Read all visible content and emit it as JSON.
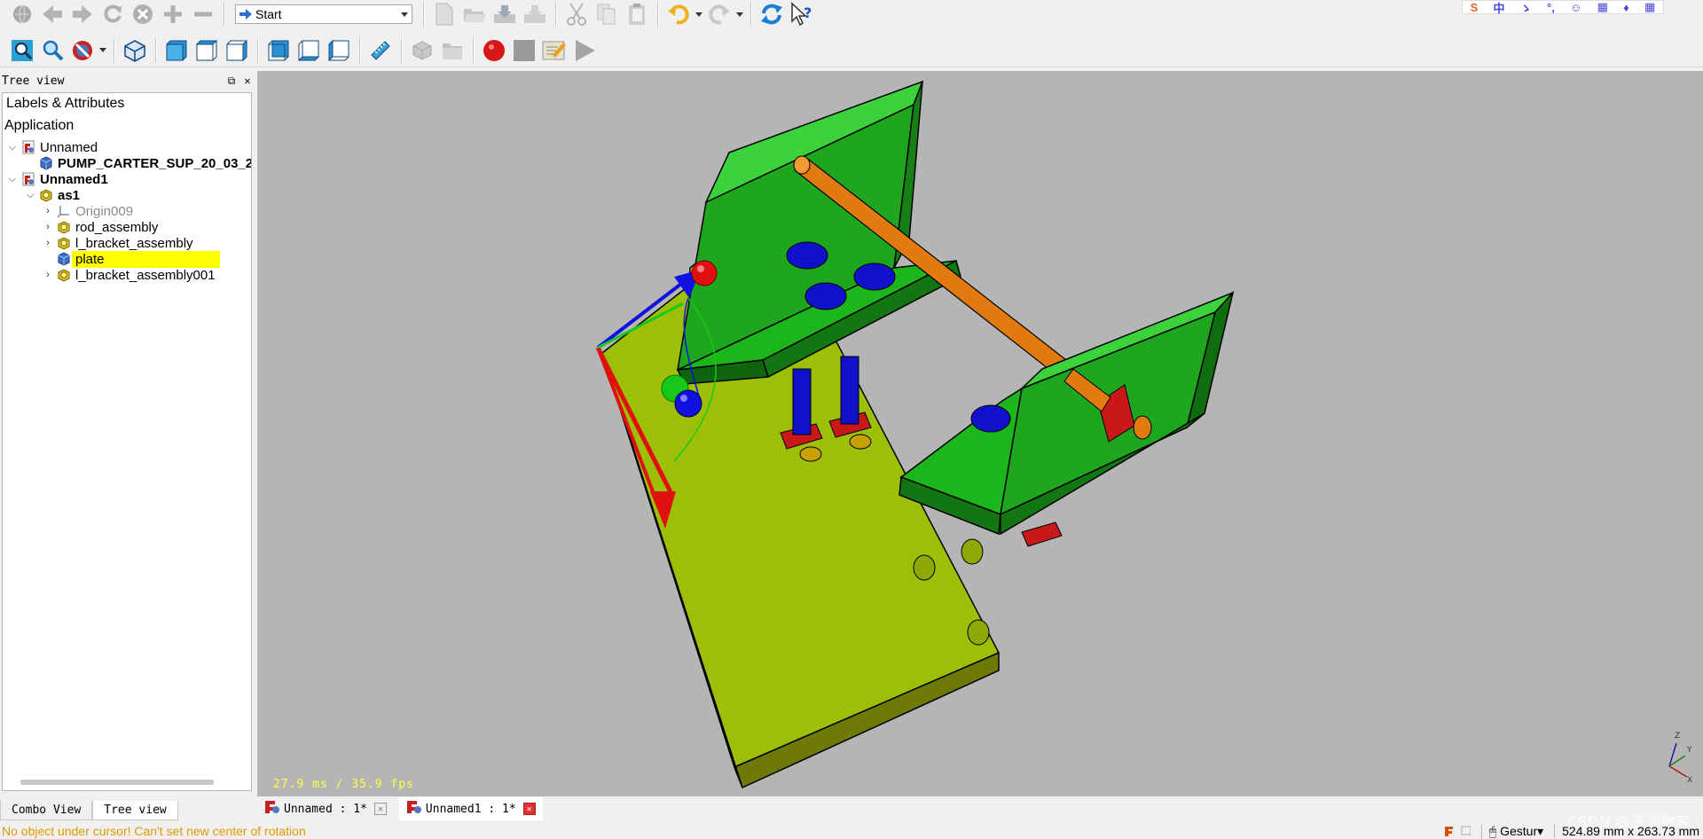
{
  "toolbar1": {
    "workbench_selected": "Start"
  },
  "brand": {
    "items": [
      "S",
      "中",
      "ゝ",
      "°,",
      "☺",
      "▦",
      "♦",
      "▦"
    ]
  },
  "tree_panel": {
    "title": "Tree view",
    "header": "Labels & Attributes",
    "section": "Application",
    "rows": [
      {
        "label": "Unnamed",
        "level": 0,
        "expanded": true,
        "style": "normal",
        "icon": "document-icon"
      },
      {
        "label": "PUMP_CARTER_SUP_20_03_2",
        "level": 1,
        "expanded": null,
        "style": "bold",
        "icon": "part-body-icon"
      },
      {
        "label": "Unnamed1",
        "level": 0,
        "expanded": true,
        "style": "bold",
        "icon": "document-icon"
      },
      {
        "label": "as1",
        "level": 1,
        "expanded": true,
        "style": "bold",
        "icon": "assembly-icon"
      },
      {
        "label": "Origin009",
        "level": 2,
        "expanded": false,
        "style": "gray",
        "icon": "origin-icon"
      },
      {
        "label": "rod_assembly",
        "level": 2,
        "expanded": false,
        "style": "normal",
        "icon": "assembly-icon"
      },
      {
        "label": "l_bracket_assembly",
        "level": 2,
        "expanded": false,
        "style": "normal",
        "icon": "assembly-icon"
      },
      {
        "label": "plate",
        "level": 2,
        "expanded": null,
        "style": "selected",
        "icon": "part-body-icon"
      },
      {
        "label": "l_bracket_assembly001",
        "level": 2,
        "expanded": false,
        "style": "normal",
        "icon": "assembly-icon"
      }
    ]
  },
  "bottom_tabs": [
    "Combo View",
    "Tree view"
  ],
  "viewport": {
    "fps_text": "27.9 ms / 35.9 fps",
    "background": "#b5b5b5",
    "colors": {
      "plate": "#9abd00",
      "bracket": "#1fb31f",
      "rod": "#e37a10",
      "pin": "#1111cc",
      "washer": "#c81818"
    }
  },
  "doc_tabs": [
    {
      "label": "Unnamed : 1*",
      "active": false
    },
    {
      "label": "Unnamed1 : 1*",
      "active": true
    }
  ],
  "status": {
    "message": "No object under cursor! Can't set new center of rotation",
    "nav_style": "Gestur▾",
    "dimensions": "524.89 mm x 263.73 mm"
  },
  "watermark": "CSDN @潇湘散客"
}
